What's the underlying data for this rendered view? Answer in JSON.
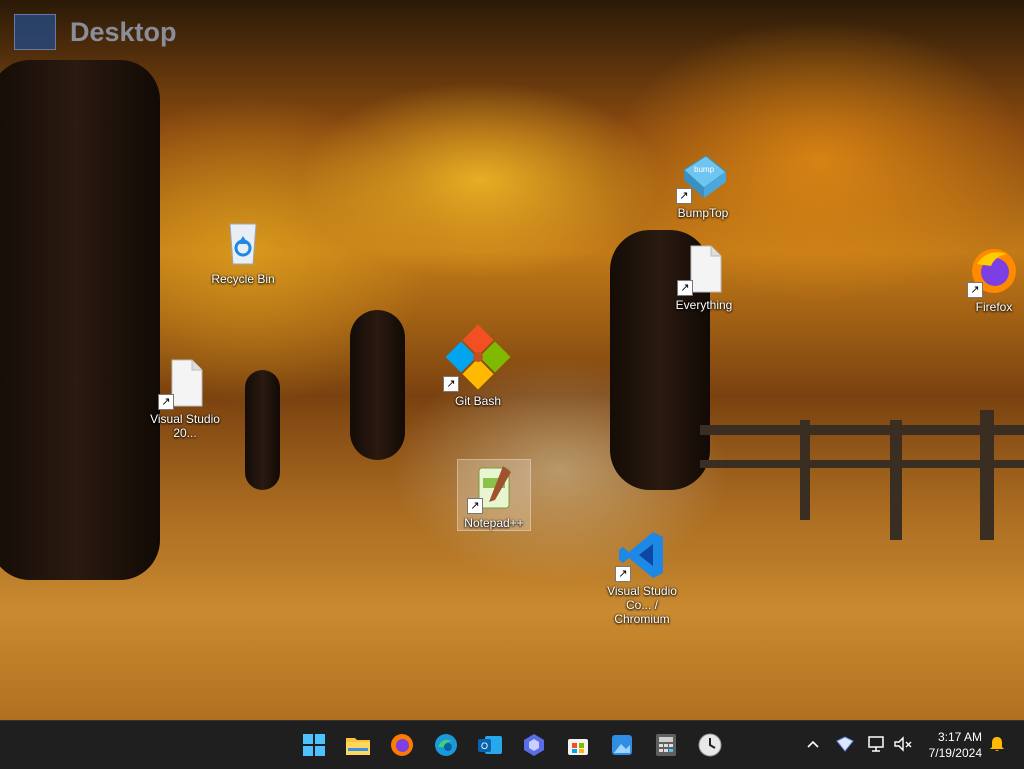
{
  "desktop": {
    "title": "Desktop",
    "icons": [
      {
        "name": "recycle-bin",
        "label": "Recycle Bin"
      },
      {
        "name": "visual-studio",
        "label": "Visual Studio 20..."
      },
      {
        "name": "git-bash",
        "label": "Git Bash"
      },
      {
        "name": "notepadpp",
        "label": "Notepad++"
      },
      {
        "name": "bumptop",
        "label": "BumpTop"
      },
      {
        "name": "everything",
        "label": "Everything"
      },
      {
        "name": "firefox",
        "label": "Firefox"
      },
      {
        "name": "vscode-chromium",
        "label": "Visual Studio Co... / Chromium"
      }
    ]
  },
  "taskbar": {
    "apps": [
      {
        "name": "start-button",
        "icon": "windows-logo"
      },
      {
        "name": "file-explorer",
        "icon": "folder-icon"
      },
      {
        "name": "firefox",
        "icon": "firefox-icon"
      },
      {
        "name": "edge",
        "icon": "edge-icon"
      },
      {
        "name": "outlook-new",
        "icon": "outlook-icon"
      },
      {
        "name": "copilot",
        "icon": "copilot-icon"
      },
      {
        "name": "microsoft-store",
        "icon": "store-icon"
      },
      {
        "name": "photos",
        "icon": "photos-icon"
      },
      {
        "name": "calculator",
        "icon": "calculator-icon"
      },
      {
        "name": "clock-app",
        "icon": "clock-icon"
      }
    ],
    "clock": {
      "time": "3:17 AM",
      "date": "7/19/2024"
    }
  }
}
